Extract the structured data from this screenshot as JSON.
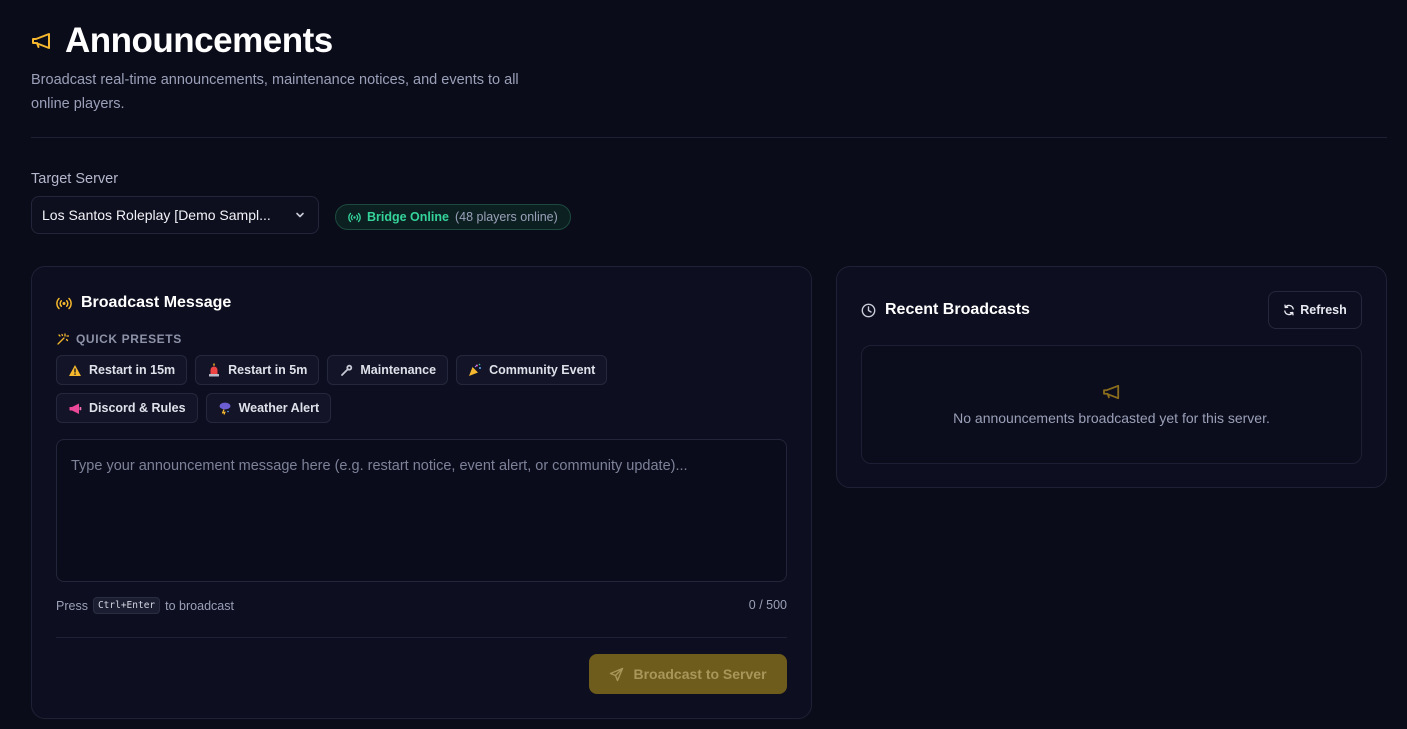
{
  "header": {
    "title": "Announcements",
    "icon": "megaphone-icon",
    "subtitle": "Broadcast real-time announcements, maintenance notices, and events to all online players."
  },
  "target": {
    "label": "Target Server",
    "selected_server": "Los Santos Roleplay [Demo Sampl...",
    "bridge_status": "Bridge Online",
    "players_online": "(48 players online)"
  },
  "broadcast": {
    "title": "Broadcast Message",
    "presets_label": "QUICK PRESETS",
    "presets": [
      {
        "label": "Restart in 15m",
        "icon": "warning-icon"
      },
      {
        "label": "Restart in 5m",
        "icon": "siren-icon"
      },
      {
        "label": "Maintenance",
        "icon": "wrench-icon"
      },
      {
        "label": "Community Event",
        "icon": "party-popper-icon"
      },
      {
        "label": "Discord & Rules",
        "icon": "loudspeaker-icon"
      },
      {
        "label": "Weather Alert",
        "icon": "storm-icon"
      }
    ],
    "message_placeholder": "Type your announcement message here (e.g. restart notice, event alert, or community update)...",
    "hint_prefix": "Press",
    "hint_key": "Ctrl+Enter",
    "hint_suffix": "to broadcast",
    "char_count": "0 / 500",
    "submit_label": "Broadcast to Server"
  },
  "recent": {
    "title": "Recent Broadcasts",
    "refresh_label": "Refresh",
    "empty_text": "No announcements broadcasted yet for this server."
  },
  "colors": {
    "background": "#0b0c1a",
    "accent": "#f5b82e",
    "online": "#34d399",
    "submit_disabled": "#6e5c1c"
  }
}
